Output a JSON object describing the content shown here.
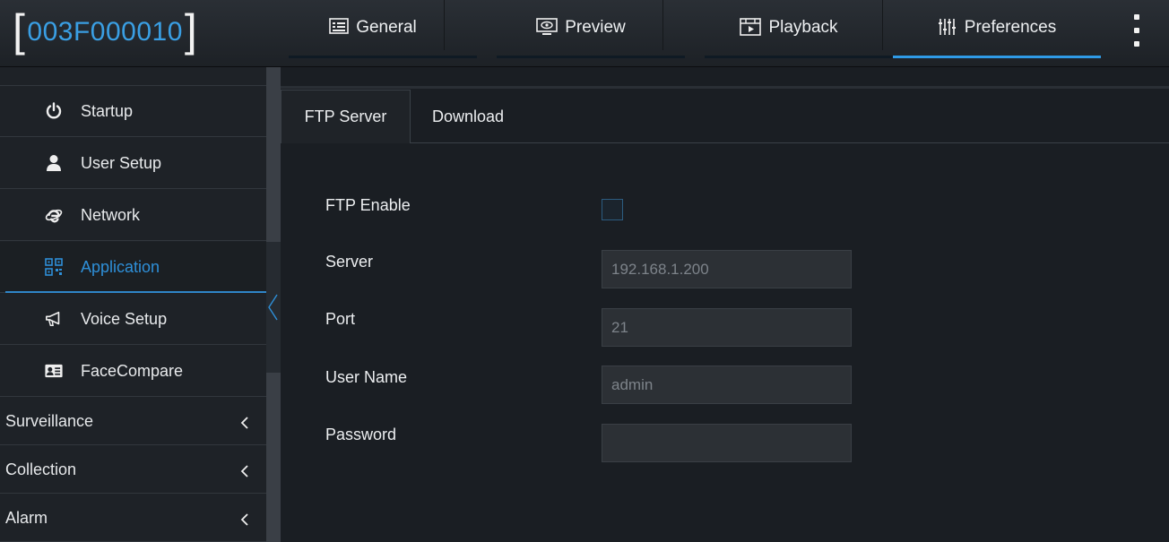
{
  "header": {
    "device_id": "003F000010",
    "tabs": [
      {
        "label": "General",
        "icon": "general-icon"
      },
      {
        "label": "Preview",
        "icon": "preview-icon"
      },
      {
        "label": "Playback",
        "icon": "playback-icon"
      },
      {
        "label": "Preferences",
        "icon": "preferences-icon"
      }
    ],
    "active_tab": "Preferences",
    "accent_color": "#2f9ae6"
  },
  "sidebar": {
    "items": [
      {
        "label": "Startup",
        "icon": "power-icon"
      },
      {
        "label": "User Setup",
        "icon": "user-icon"
      },
      {
        "label": "Network",
        "icon": "network-icon"
      },
      {
        "label": "Application",
        "icon": "application-icon"
      },
      {
        "label": "Voice Setup",
        "icon": "megaphone-icon"
      },
      {
        "label": "FaceCompare",
        "icon": "id-card-icon"
      }
    ],
    "active_item": "Application",
    "groups": [
      {
        "label": "Surveillance"
      },
      {
        "label": "Collection"
      },
      {
        "label": "Alarm"
      }
    ]
  },
  "main": {
    "subtabs": [
      {
        "label": "FTP Server"
      },
      {
        "label": "Download"
      }
    ],
    "active_subtab": "FTP Server",
    "form": {
      "ftp_enable_label": "FTP Enable",
      "ftp_enabled": false,
      "server_label": "Server",
      "server_value": "192.168.1.200",
      "port_label": "Port",
      "port_value": "21",
      "username_label": "User Name",
      "username_value": "admin",
      "password_label": "Password",
      "password_value": ""
    }
  }
}
